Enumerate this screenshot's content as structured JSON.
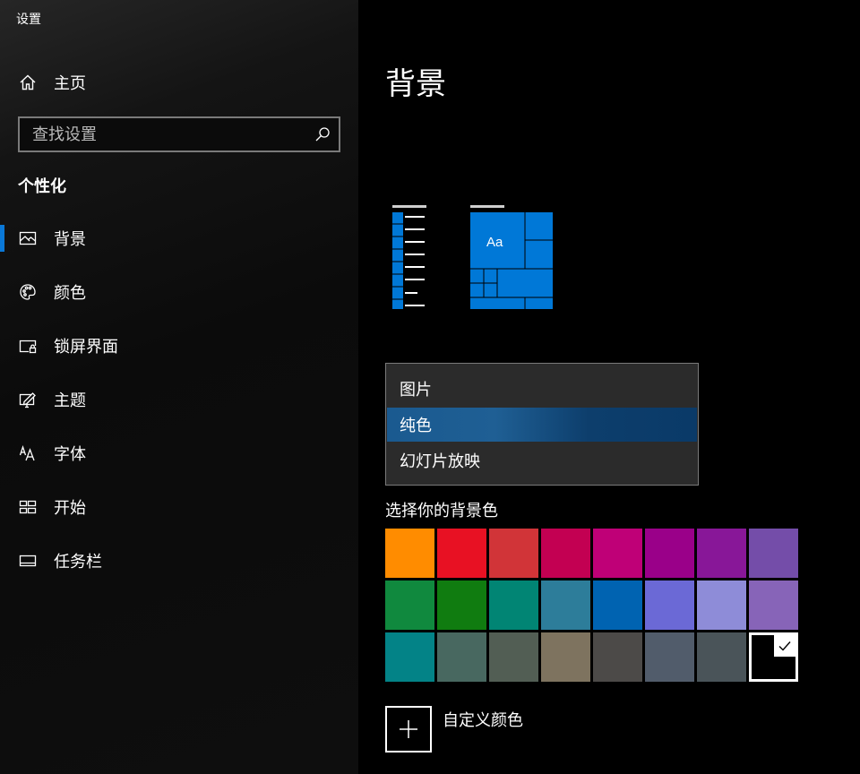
{
  "app": {
    "title": "设置"
  },
  "sidebar": {
    "home_label": "主页",
    "search": {
      "placeholder": "查找设置",
      "value": ""
    },
    "section_title": "个性化",
    "items": [
      {
        "label": "背景",
        "icon": "picture-icon",
        "active": true
      },
      {
        "label": "颜色",
        "icon": "palette-icon",
        "active": false
      },
      {
        "label": "锁屏界面",
        "icon": "lock-screen-icon",
        "active": false
      },
      {
        "label": "主题",
        "icon": "theme-icon",
        "active": false
      },
      {
        "label": "字体",
        "icon": "font-icon",
        "active": false
      },
      {
        "label": "开始",
        "icon": "start-icon",
        "active": false
      },
      {
        "label": "任务栏",
        "icon": "taskbar-icon",
        "active": false
      }
    ]
  },
  "main": {
    "title": "背景",
    "preview": {
      "tile_text": "Aa",
      "accent": "#0078d7"
    },
    "background_dropdown": {
      "options": [
        "图片",
        "纯色",
        "幻灯片放映"
      ],
      "selected_index": 1
    },
    "color_section_label": "选择你的背景色",
    "colors": [
      "#ff8c00",
      "#e81123",
      "#d13438",
      "#c30052",
      "#bf0077",
      "#9a0089",
      "#881798",
      "#744da9",
      "#10893e",
      "#107c10",
      "#018574",
      "#2d7d9a",
      "#0063b1",
      "#6b69d6",
      "#8e8cd8",
      "#8764b8",
      "#038387",
      "#486860",
      "#525e54",
      "#7e735f",
      "#4c4a48",
      "#515c6b",
      "#4a5459",
      "#000000"
    ],
    "selected_color_index": 23,
    "custom_color_label": "自定义颜色"
  },
  "colors": {
    "accent": "#0a78d7",
    "sidebar_bg": "#141414",
    "main_bg": "#000000"
  }
}
